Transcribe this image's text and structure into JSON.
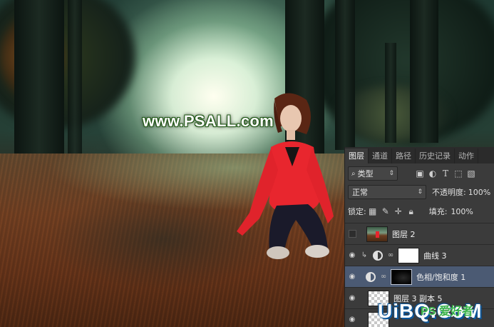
{
  "watermark_top": "www.PSALL.com",
  "panel": {
    "tabs": [
      "图层",
      "通道",
      "路径",
      "历史记录",
      "动作"
    ],
    "active_tab": 0,
    "filter": {
      "label": "类型"
    },
    "blend_mode": "正常",
    "opacity_label": "不透明度:",
    "opacity_value": "100%",
    "lock_label": "锁定:",
    "fill_label": "填充:",
    "fill_value": "100%",
    "layers": [
      {
        "name": "图层 2",
        "visible": false,
        "thumb": "photo"
      },
      {
        "name": "曲线 3",
        "visible": true,
        "thumb": "white-mask",
        "clipped": true,
        "adjustment": "curves"
      },
      {
        "name": "色相/饱和度 1",
        "visible": true,
        "thumb": "black-mask",
        "selected": true,
        "adjustment": "hue-saturation"
      },
      {
        "name": "图层 3 副本 5",
        "visible": true,
        "thumb": "transparent"
      },
      {
        "name": "",
        "visible": true,
        "thumb": "transparent"
      }
    ]
  },
  "watermark_bottom": {
    "latin": "UiBQ.CoM",
    "cjk": "PS 爱好者"
  },
  "colors": {
    "panel_bg": "#3b3b3b",
    "selected_row": "#4b5a73",
    "watermark_outline": "#24601a"
  }
}
